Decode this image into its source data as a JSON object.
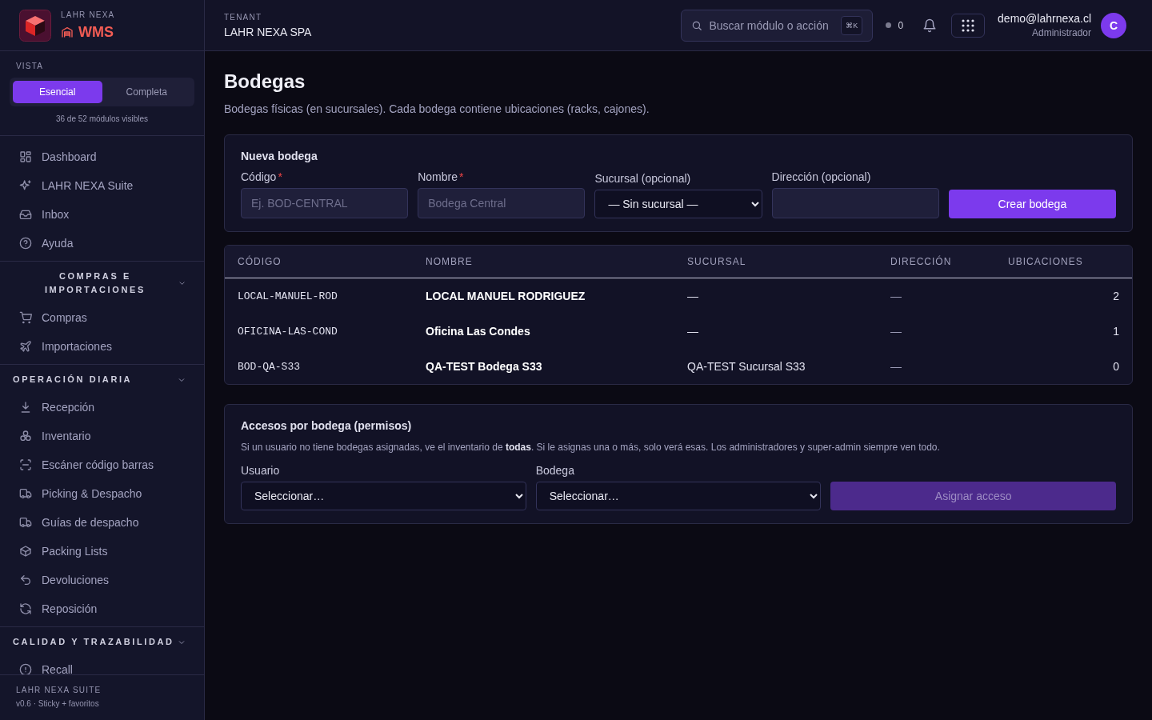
{
  "sidebar": {
    "brand": {
      "company": "LAHR NEXA",
      "product": "WMS"
    },
    "view": {
      "label": "VISTA",
      "options": [
        {
          "label": "Esencial",
          "selected": true
        },
        {
          "label": "Completa",
          "selected": false
        }
      ],
      "note": "36 de 52 módulos visibles"
    },
    "sections": [
      {
        "items": [
          {
            "label": "Dashboard"
          },
          {
            "label": "LAHR NEXA Suite"
          },
          {
            "label": "Inbox"
          },
          {
            "label": "Ayuda"
          }
        ]
      },
      {
        "title": "COMPRAS E IMPORTACIONES",
        "expanded": true,
        "items": [
          {
            "label": "Compras"
          },
          {
            "label": "Importaciones"
          }
        ]
      },
      {
        "title": "OPERACIÓN DIARIA",
        "expanded": true,
        "items": [
          {
            "label": "Recepción"
          },
          {
            "label": "Inventario"
          },
          {
            "label": "Escáner código barras"
          },
          {
            "label": "Picking & Despacho"
          },
          {
            "label": "Guías de despacho"
          },
          {
            "label": "Packing Lists"
          },
          {
            "label": "Devoluciones"
          },
          {
            "label": "Reposición"
          }
        ]
      },
      {
        "title": "CALIDAD Y TRAZABILIDAD",
        "expanded": true,
        "items": [
          {
            "label": "Recall"
          }
        ]
      }
    ],
    "footer": {
      "title": "LAHR NEXA SUITE",
      "version": "v0.6 · Sticky + favoritos"
    }
  },
  "topbar": {
    "tenant_label": "TENANT",
    "tenant": "LAHR NEXA SPA",
    "search": {
      "placeholder": "Buscar módulo o acción",
      "shortcut": "⌘K"
    },
    "status_count": "0",
    "user": {
      "email": "demo@lahrnexa.cl",
      "role": "Administrador",
      "initial": "C"
    }
  },
  "page": {
    "title": "Bodegas",
    "subtitle": "Bodegas físicas (en sucursales). Cada bodega contiene ubicaciones (racks, cajones).",
    "new_form": {
      "title": "Nueva bodega",
      "fields": [
        {
          "kind": "input",
          "label": "Código",
          "required": true,
          "marker": "*",
          "placeholder": "Ej. BOD-CENTRAL"
        },
        {
          "kind": "input",
          "label": "Nombre",
          "required": true,
          "marker": "*",
          "placeholder": "Bodega Central"
        },
        {
          "kind": "select",
          "label": "Sucursal (opcional)",
          "required": false,
          "value": "— Sin sucursal —"
        },
        {
          "kind": "input",
          "label": "Dirección (opcional)",
          "required": false
        }
      ],
      "submit": {
        "label": "Crear bodega",
        "disabled": false
      }
    },
    "table": {
      "columns": [
        "CÓDIGO",
        "NOMBRE",
        "SUCURSAL",
        "DIRECCIÓN",
        "UBICACIONES"
      ],
      "rows": [
        [
          "LOCAL-MANUEL-ROD",
          "LOCAL MANUEL RODRIGUEZ",
          "—",
          "—",
          "2"
        ],
        [
          "OFICINA-LAS-COND",
          "Oficina Las Condes",
          "—",
          "—",
          "1"
        ],
        [
          "BOD-QA-S33",
          "QA-TEST Bodega S33",
          "QA-TEST Sucursal S33",
          "—",
          "0"
        ]
      ]
    },
    "access": {
      "title": "Accesos por bodega (permisos)",
      "note": "Si un usuario no tiene bodegas asignadas, ve el inventario de **todas**. Si le asignas una o más, solo verá esas. Los administradores y super-admin siempre ven todo.",
      "fields": [
        {
          "label": "Usuario",
          "value": "Seleccionar…"
        },
        {
          "label": "Bodega",
          "value": "Seleccionar…"
        }
      ],
      "submit": {
        "label": "Asignar acceso",
        "disabled": true
      }
    }
  }
}
